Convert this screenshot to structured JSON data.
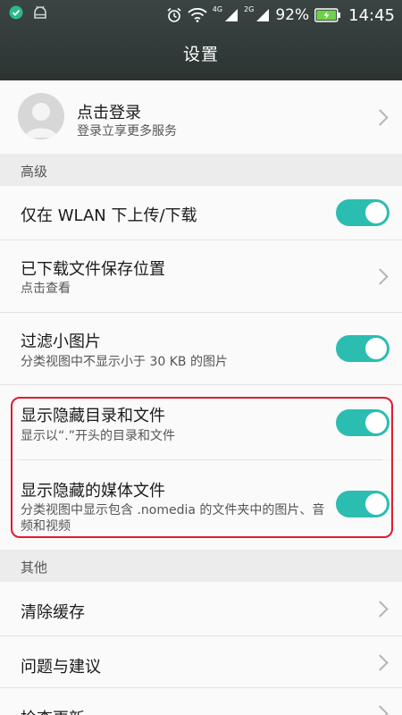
{
  "status_bar": {
    "network_4g": "4G",
    "network_2g": "2G",
    "battery_percent": "92%",
    "time": "14:45"
  },
  "app_bar": {
    "title": "设置"
  },
  "account": {
    "title": "点击登录",
    "subtitle": "登录立享更多服务"
  },
  "sections": {
    "advanced": "高级",
    "other": "其他"
  },
  "advanced_items": {
    "wlan_only": {
      "title": "仅在 WLAN 下上传/下载",
      "enabled": true
    },
    "download_location": {
      "title": "已下载文件保存位置",
      "subtitle": "点击查看"
    },
    "filter_images": {
      "title": "过滤小图片",
      "subtitle": "分类视图中不显示小于 30 KB 的图片",
      "enabled": true
    },
    "show_hidden_dirs": {
      "title": "显示隐藏目录和文件",
      "subtitle": "显示以“.”开头的目录和文件",
      "enabled": true
    },
    "show_hidden_media": {
      "title": "显示隐藏的媒体文件",
      "subtitle": "分类视图中显示包含 .nomedia 的文件夹中的图片、音频和视频",
      "enabled": true
    }
  },
  "other_items": {
    "clear_cache": {
      "title": "清除缓存"
    },
    "feedback": {
      "title": "问题与建议"
    },
    "check_update": {
      "title": "检查更新"
    }
  },
  "colors": {
    "app_bar": "#323b39",
    "toggle_on": "#2cbdb1",
    "highlight": "#e21b2b"
  }
}
